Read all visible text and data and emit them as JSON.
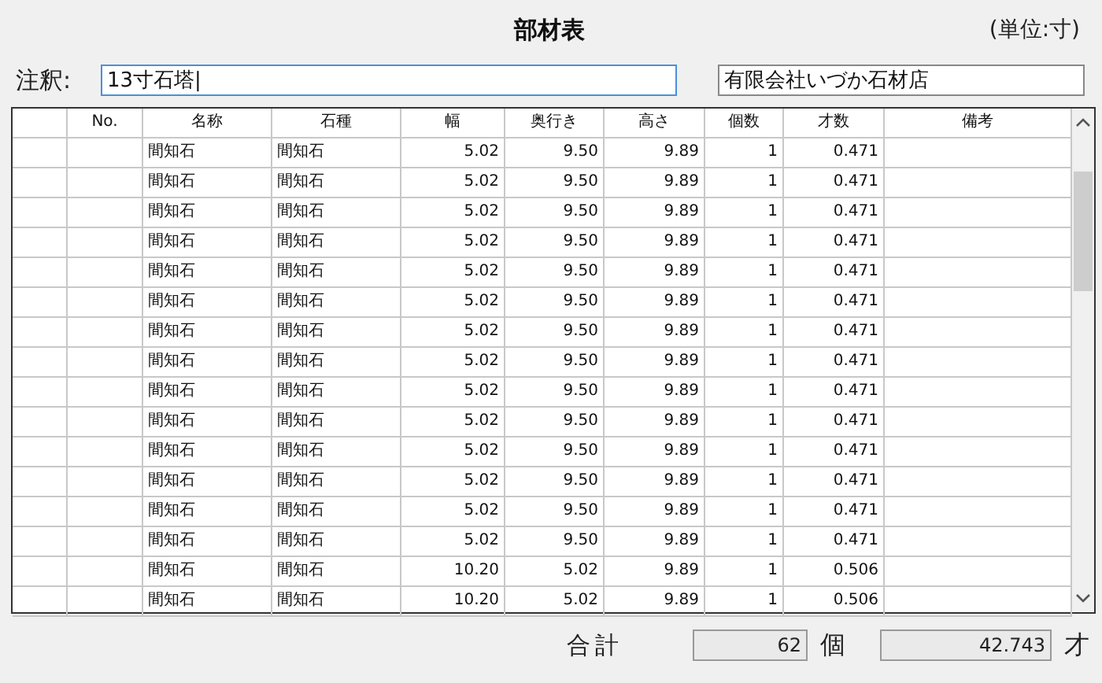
{
  "title": "部材表",
  "unit": "(単位:寸)",
  "note": {
    "label": "注釈:",
    "value": "13寸石塔|"
  },
  "company": {
    "value": "有限会社いづか石材店"
  },
  "table": {
    "columns": [
      "No.",
      "名称",
      "石種",
      "幅",
      "奥行き",
      "高さ",
      "個数",
      "才数",
      "備考"
    ],
    "rows": [
      {
        "cells": [
          "間知石",
          "間知石",
          "5.02",
          "9.50",
          "9.89",
          "1",
          "0.471"
        ]
      },
      {
        "cells": [
          "間知石",
          "間知石",
          "5.02",
          "9.50",
          "9.89",
          "1",
          "0.471"
        ]
      },
      {
        "cells": [
          "間知石",
          "間知石",
          "5.02",
          "9.50",
          "9.89",
          "1",
          "0.471"
        ]
      },
      {
        "cells": [
          "間知石",
          "間知石",
          "5.02",
          "9.50",
          "9.89",
          "1",
          "0.471"
        ]
      },
      {
        "cells": [
          "間知石",
          "間知石",
          "5.02",
          "9.50",
          "9.89",
          "1",
          "0.471"
        ]
      },
      {
        "cells": [
          "間知石",
          "間知石",
          "5.02",
          "9.50",
          "9.89",
          "1",
          "0.471"
        ]
      },
      {
        "cells": [
          "間知石",
          "間知石",
          "5.02",
          "9.50",
          "9.89",
          "1",
          "0.471"
        ]
      },
      {
        "cells": [
          "間知石",
          "間知石",
          "5.02",
          "9.50",
          "9.89",
          "1",
          "0.471"
        ]
      },
      {
        "cells": [
          "間知石",
          "間知石",
          "5.02",
          "9.50",
          "9.89",
          "1",
          "0.471"
        ]
      },
      {
        "cells": [
          "間知石",
          "間知石",
          "5.02",
          "9.50",
          "9.89",
          "1",
          "0.471"
        ]
      },
      {
        "cells": [
          "間知石",
          "間知石",
          "5.02",
          "9.50",
          "9.89",
          "1",
          "0.471"
        ]
      },
      {
        "cells": [
          "間知石",
          "間知石",
          "5.02",
          "9.50",
          "9.89",
          "1",
          "0.471"
        ]
      },
      {
        "cells": [
          "間知石",
          "間知石",
          "5.02",
          "9.50",
          "9.89",
          "1",
          "0.471"
        ]
      },
      {
        "cells": [
          "間知石",
          "間知石",
          "5.02",
          "9.50",
          "9.89",
          "1",
          "0.471"
        ]
      },
      {
        "cells": [
          "間知石",
          "間知石",
          "10.20",
          "5.02",
          "9.89",
          "1",
          "0.506"
        ]
      },
      {
        "cells": [
          "間知石",
          "間知石",
          "10.20",
          "5.02",
          "9.89",
          "1",
          "0.506"
        ]
      }
    ]
  },
  "totals": {
    "label": "合計",
    "count": "62",
    "count_unit": "個",
    "sai": "42.743",
    "sai_unit": "才"
  }
}
